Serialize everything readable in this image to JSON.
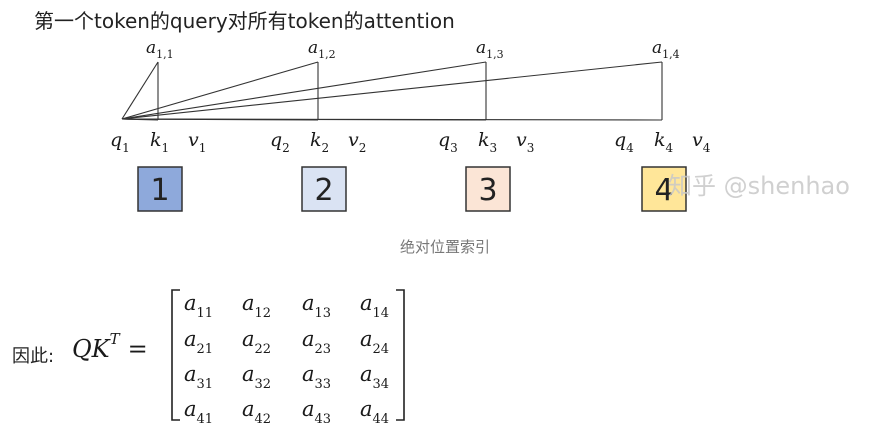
{
  "title": "第一个token的query对所有token的attention",
  "attention_labels": [
    {
      "base": "a",
      "sub": "1,1"
    },
    {
      "base": "a",
      "sub": "1,2"
    },
    {
      "base": "a",
      "sub": "1,3"
    },
    {
      "base": "a",
      "sub": "1,4"
    }
  ],
  "tokens": [
    {
      "q": "q",
      "k": "k",
      "v": "v",
      "index": "1",
      "box_label": "1",
      "box_color": "#8ea9db"
    },
    {
      "q": "q",
      "k": "k",
      "v": "v",
      "index": "2",
      "box_label": "2",
      "box_color": "#dae3f3"
    },
    {
      "q": "q",
      "k": "k",
      "v": "v",
      "index": "3",
      "box_label": "3",
      "box_color": "#fbe5d6"
    },
    {
      "q": "q",
      "k": "k",
      "v": "v",
      "index": "4",
      "box_label": "4",
      "box_color": "#ffe699"
    }
  ],
  "watermark": "知乎 @shenhao",
  "caption": "绝对位置索引",
  "formula": {
    "prefix": "因此:",
    "lhs_base": "QK",
    "lhs_sup": "T",
    "eq": "=",
    "matrix": [
      [
        {
          "base": "a",
          "sub": "11"
        },
        {
          "base": "a",
          "sub": "12"
        },
        {
          "base": "a",
          "sub": "13"
        },
        {
          "base": "a",
          "sub": "14"
        }
      ],
      [
        {
          "base": "a",
          "sub": "21"
        },
        {
          "base": "a",
          "sub": "22"
        },
        {
          "base": "a",
          "sub": "23"
        },
        {
          "base": "a",
          "sub": "24"
        }
      ],
      [
        {
          "base": "a",
          "sub": "31"
        },
        {
          "base": "a",
          "sub": "32"
        },
        {
          "base": "a",
          "sub": "33"
        },
        {
          "base": "a",
          "sub": "34"
        }
      ],
      [
        {
          "base": "a",
          "sub": "41"
        },
        {
          "base": "a",
          "sub": "42"
        },
        {
          "base": "a",
          "sub": "43"
        },
        {
          "base": "a",
          "sub": "44"
        }
      ]
    ]
  }
}
